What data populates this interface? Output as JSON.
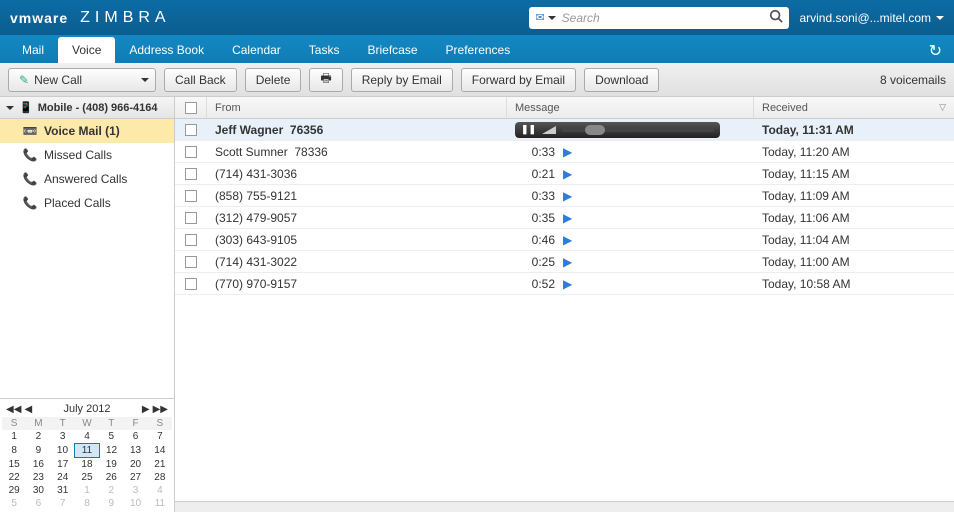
{
  "header": {
    "logo_vmware": "vmware",
    "logo_zimbra": "ZIMBRA",
    "search_placeholder": "Search",
    "user": "arvind.soni@...mitel.com"
  },
  "tabs": {
    "items": [
      "Mail",
      "Voice",
      "Address Book",
      "Calendar",
      "Tasks",
      "Briefcase",
      "Preferences"
    ],
    "active_index": 1
  },
  "toolbar": {
    "new_call": "New Call",
    "call_back": "Call Back",
    "delete": "Delete",
    "reply_email": "Reply by Email",
    "forward_email": "Forward by Email",
    "download": "Download",
    "status": "8 voicemails"
  },
  "sidebar": {
    "account": "Mobile - (408) 966-4164",
    "items": [
      {
        "label": "Voice Mail (1)",
        "icon": "voicemail",
        "selected": true
      },
      {
        "label": "Missed Calls",
        "icon": "missed",
        "selected": false
      },
      {
        "label": "Answered Calls",
        "icon": "answered",
        "selected": false
      },
      {
        "label": "Placed Calls",
        "icon": "placed",
        "selected": false
      }
    ]
  },
  "calendar": {
    "title": "July 2012",
    "dow": [
      "S",
      "M",
      "T",
      "W",
      "T",
      "F",
      "S"
    ],
    "weeks": [
      [
        {
          "d": 1
        },
        {
          "d": 2
        },
        {
          "d": 3
        },
        {
          "d": 4
        },
        {
          "d": 5
        },
        {
          "d": 6
        },
        {
          "d": 7
        }
      ],
      [
        {
          "d": 8
        },
        {
          "d": 9
        },
        {
          "d": 10
        },
        {
          "d": 11,
          "today": true
        },
        {
          "d": 12
        },
        {
          "d": 13
        },
        {
          "d": 14
        }
      ],
      [
        {
          "d": 15
        },
        {
          "d": 16
        },
        {
          "d": 17
        },
        {
          "d": 18
        },
        {
          "d": 19
        },
        {
          "d": 20
        },
        {
          "d": 21
        }
      ],
      [
        {
          "d": 22
        },
        {
          "d": 23
        },
        {
          "d": 24
        },
        {
          "d": 25
        },
        {
          "d": 26
        },
        {
          "d": 27
        },
        {
          "d": 28
        }
      ],
      [
        {
          "d": 29
        },
        {
          "d": 30
        },
        {
          "d": 31
        },
        {
          "d": 1,
          "other": true
        },
        {
          "d": 2,
          "other": true
        },
        {
          "d": 3,
          "other": true
        },
        {
          "d": 4,
          "other": true
        }
      ],
      [
        {
          "d": 5,
          "other": true
        },
        {
          "d": 6,
          "other": true
        },
        {
          "d": 7,
          "other": true
        },
        {
          "d": 8,
          "other": true
        },
        {
          "d": 9,
          "other": true
        },
        {
          "d": 10,
          "other": true
        },
        {
          "d": 11,
          "other": true
        }
      ]
    ]
  },
  "columns": {
    "from": "From",
    "message": "Message",
    "received": "Received"
  },
  "voicemails": [
    {
      "from": "Jeff Wagner",
      "ext": "76356",
      "duration": "",
      "received": "Today, 11:31 AM",
      "selected": true,
      "playing": true
    },
    {
      "from": "Scott Sumner",
      "ext": "78336",
      "duration": "0:33",
      "received": "Today, 11:20 AM"
    },
    {
      "from": "(714) 431-3036",
      "ext": "",
      "duration": "0:21",
      "received": "Today, 11:15 AM"
    },
    {
      "from": "(858) 755-9121",
      "ext": "",
      "duration": "0:33",
      "received": "Today, 11:09 AM"
    },
    {
      "from": "(312) 479-9057",
      "ext": "",
      "duration": "0:35",
      "received": "Today, 11:06 AM"
    },
    {
      "from": "(303) 643-9105",
      "ext": "",
      "duration": "0:46",
      "received": "Today, 11:04 AM"
    },
    {
      "from": "(714) 431-3022",
      "ext": "",
      "duration": "0:25",
      "received": "Today, 11:00 AM"
    },
    {
      "from": "(770) 970-9157",
      "ext": "",
      "duration": "0:52",
      "received": "Today, 10:58 AM"
    }
  ]
}
